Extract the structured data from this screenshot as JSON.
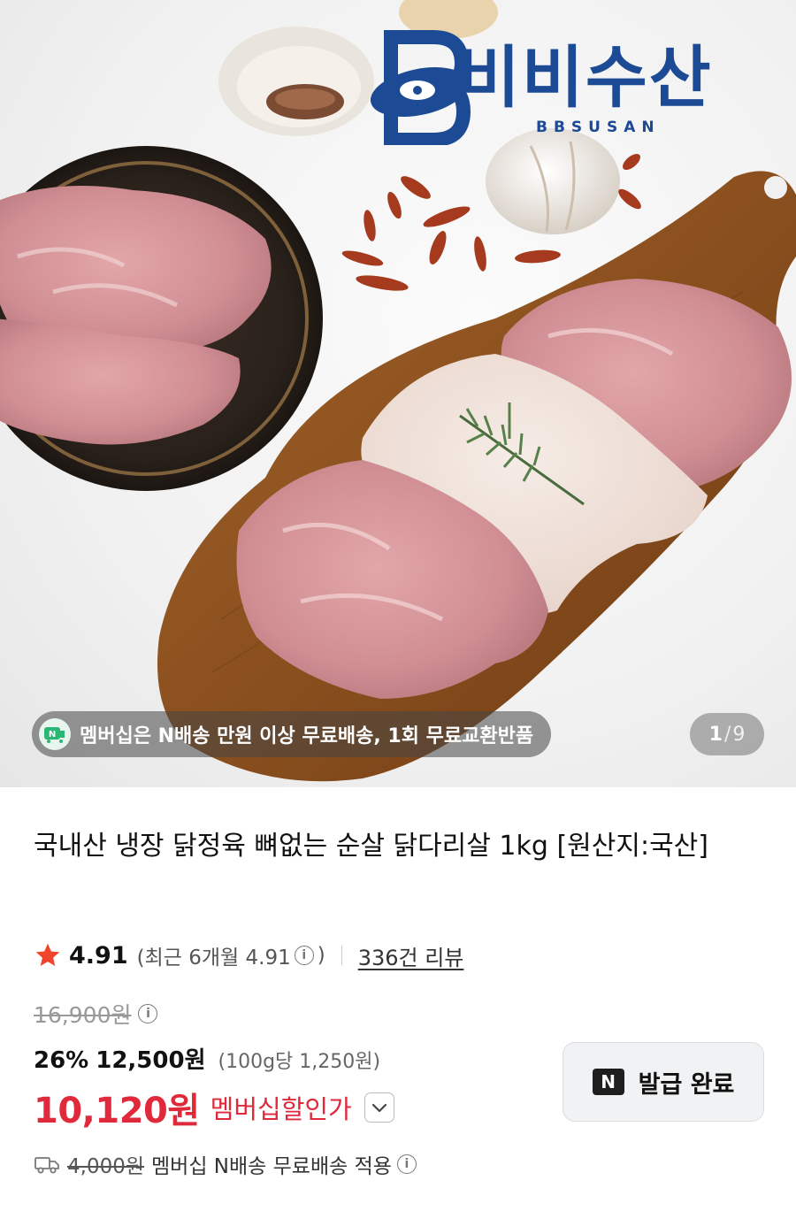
{
  "hero": {
    "brand_name": "비비수산",
    "brand_sub": "BBSUSAN",
    "promo_icon": "n-delivery-icon",
    "promo_text": "멤버십은 N배송 만원 이상 무료배송, 1회 무료교환반품",
    "page_current": "1",
    "page_separator": "/",
    "page_total": "9"
  },
  "product": {
    "title": "국내산 냉장 닭정육 뼈없는 순살 닭다리살 1kg [원산지:국산]",
    "rating": {
      "score": "4.91",
      "recent": "(최근 6개월 4.91",
      "recent_close": ")",
      "reviews": "336건 리뷰"
    },
    "price": {
      "original": "16,900원",
      "discount_rate": "26%",
      "sale": "12,500원",
      "unit": "(100g당 1,250원)",
      "member": "10,120원",
      "member_label": "멤버십할인가"
    },
    "coupon": {
      "badge": "N",
      "label": "발급 완료"
    },
    "shipping": {
      "icon": "truck-icon",
      "fee": "4,000원",
      "text": "멤버십 N배송 무료배송 적용"
    }
  },
  "colors": {
    "brand": "#1c4a94",
    "member_price": "#e02a3b",
    "star": "#f0442c"
  }
}
